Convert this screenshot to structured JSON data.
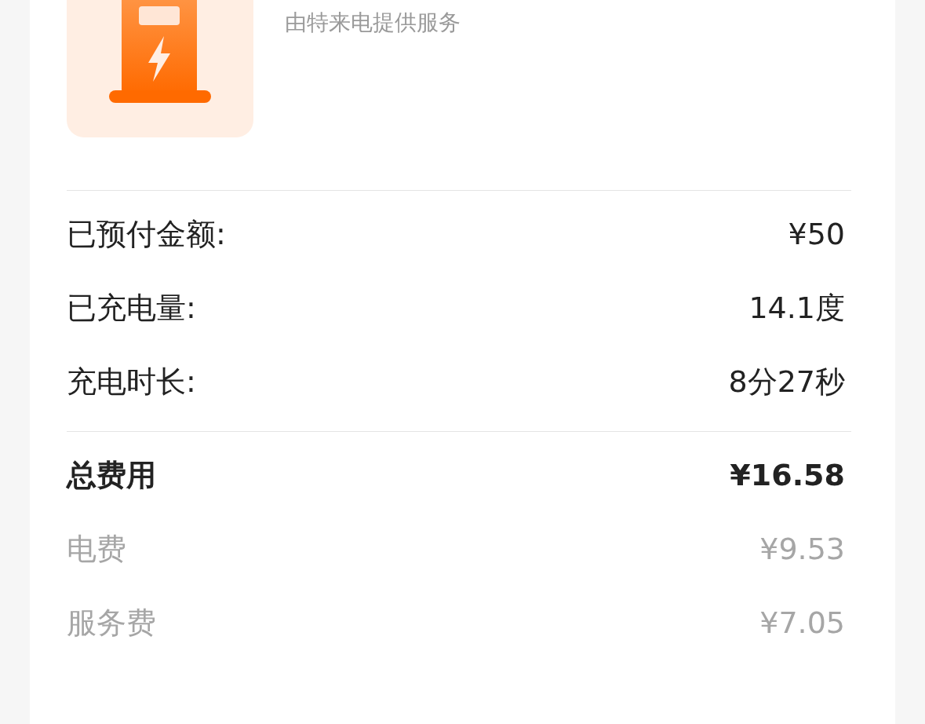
{
  "provider": {
    "subtitle": "由特来电提供服务"
  },
  "details": [
    {
      "label": "已预付金额:",
      "value": "¥50"
    },
    {
      "label": "已充电量:",
      "value": "14.1度"
    },
    {
      "label": "充电时长:",
      "value": "8分27秒"
    }
  ],
  "fees": [
    {
      "kind": "total",
      "label": "总费用",
      "value": "¥16.58"
    },
    {
      "kind": "sub",
      "label": "电费",
      "value": "¥9.53"
    },
    {
      "kind": "sub",
      "label": "服务费",
      "value": "¥7.05"
    }
  ]
}
